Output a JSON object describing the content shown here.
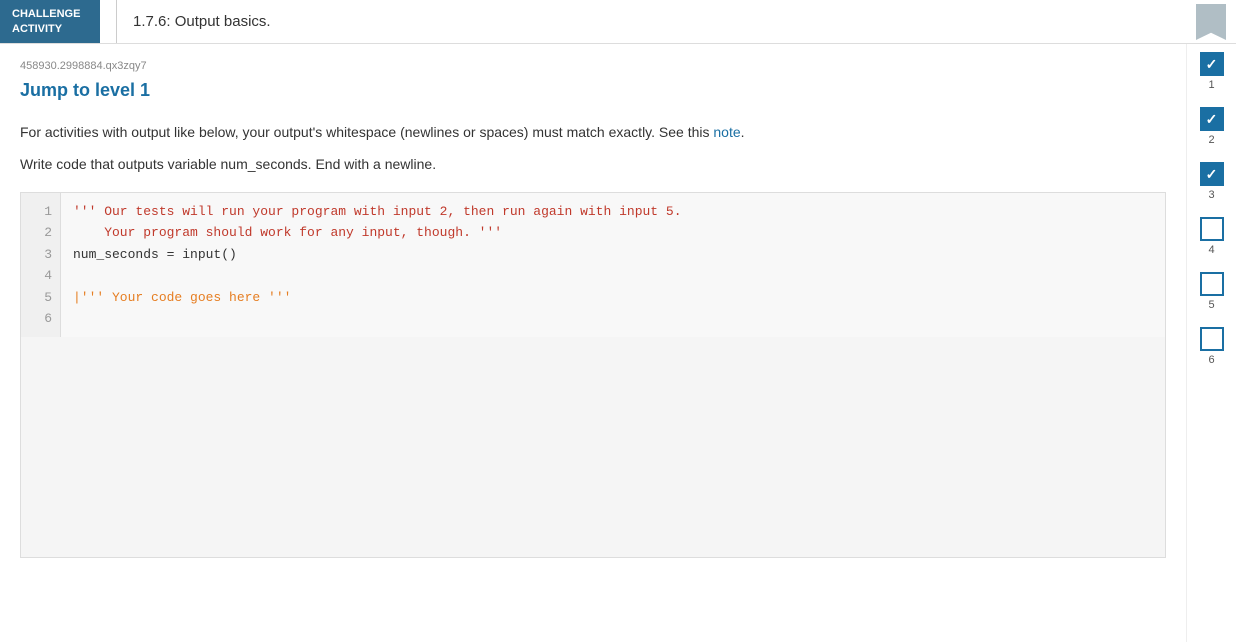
{
  "header": {
    "badge_line1": "CHALLENGE",
    "badge_line2": "ACTIVITY",
    "title": "1.7.6: Output basics.",
    "bookmark_color": "#b0bec5"
  },
  "content": {
    "activity_id": "458930.2998884.qx3zqy7",
    "jump_to_level_label": "Jump to level 1",
    "instruction1": "For activities with output like below, your output's whitespace (newlines or spaces) must match exactly. See this ",
    "note_link": "note",
    "instruction1_end": ".",
    "instruction2": "Write code that outputs variable num_seconds. End with a newline."
  },
  "code_lines": [
    {
      "number": "1",
      "text": "''' Our tests will run your program with input 2, then run again with input 5.",
      "type": "comment"
    },
    {
      "number": "2",
      "text": "    Your program should work for any input, though. '''",
      "type": "comment"
    },
    {
      "number": "3",
      "text": "num_seconds = input()",
      "type": "normal"
    },
    {
      "number": "4",
      "text": "",
      "type": "normal"
    },
    {
      "number": "5",
      "text": "''' Your code goes here '''",
      "type": "highlight"
    },
    {
      "number": "6",
      "text": "",
      "type": "normal"
    }
  ],
  "sidebar": {
    "levels": [
      {
        "number": "1",
        "checked": true
      },
      {
        "number": "2",
        "checked": true
      },
      {
        "number": "3",
        "checked": true
      },
      {
        "number": "4",
        "checked": false
      },
      {
        "number": "5",
        "checked": false
      },
      {
        "number": "6",
        "checked": false
      }
    ]
  }
}
